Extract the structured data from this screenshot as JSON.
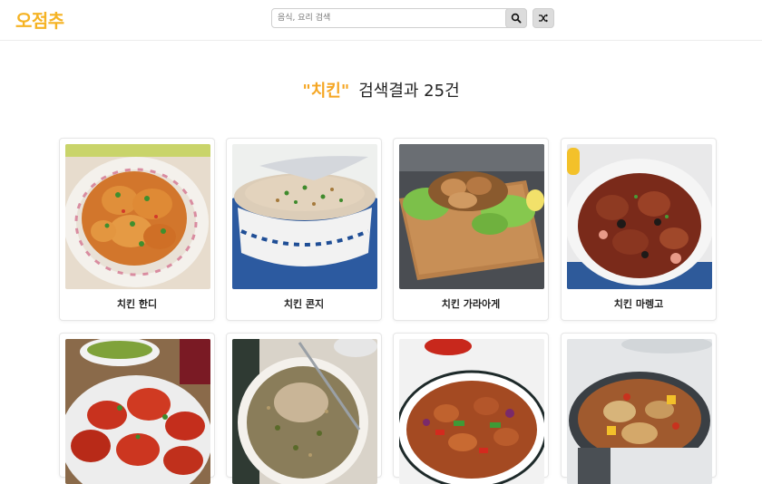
{
  "header": {
    "logo": "오점추",
    "search": {
      "placeholder": "음식, 요리 검색",
      "value": ""
    },
    "search_icon": "search-icon",
    "shuffle_icon": "shuffle-icon"
  },
  "results": {
    "keyword": "\"치킨\"",
    "summary": "검색결과 25건"
  },
  "recipes": [
    {
      "name": "치킨 한디"
    },
    {
      "name": "치킨 콘지"
    },
    {
      "name": "치킨 가라아게"
    },
    {
      "name": "치킨 마렝고"
    },
    {
      "name": ""
    },
    {
      "name": ""
    },
    {
      "name": ""
    },
    {
      "name": ""
    }
  ],
  "colors": {
    "brand": "#f5b324",
    "keyword": "#f5a623"
  }
}
